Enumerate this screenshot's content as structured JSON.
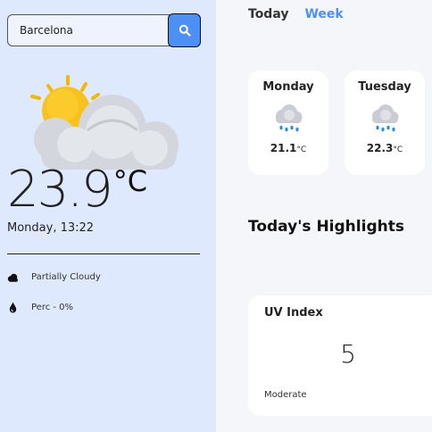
{
  "search": {
    "value": "Barcelona"
  },
  "current": {
    "temp": "23.9",
    "unit": "°C",
    "datetime": "Monday, 13:22",
    "conditions": [
      {
        "icon": "cloud-icon",
        "label": "Partially Cloudy"
      },
      {
        "icon": "drop-icon",
        "label": "Perc - 0%"
      }
    ]
  },
  "tabs": {
    "today": "Today",
    "week": "Week"
  },
  "forecast": [
    {
      "day": "Monday",
      "temp": "21.1",
      "unit": "°C",
      "icon": "rain-cloud-icon"
    },
    {
      "day": "Tuesday",
      "temp": "22.3",
      "unit": "°C",
      "icon": "rain-cloud-icon"
    }
  ],
  "highlights": {
    "title": "Today's Highlights",
    "uv": {
      "title": "UV Index",
      "value": "5",
      "level": "Moderate"
    }
  },
  "colors": {
    "accent": "#4c8ff5",
    "sidebar_bg": "#dfe9fd",
    "main_bg": "#f5f6fa"
  }
}
